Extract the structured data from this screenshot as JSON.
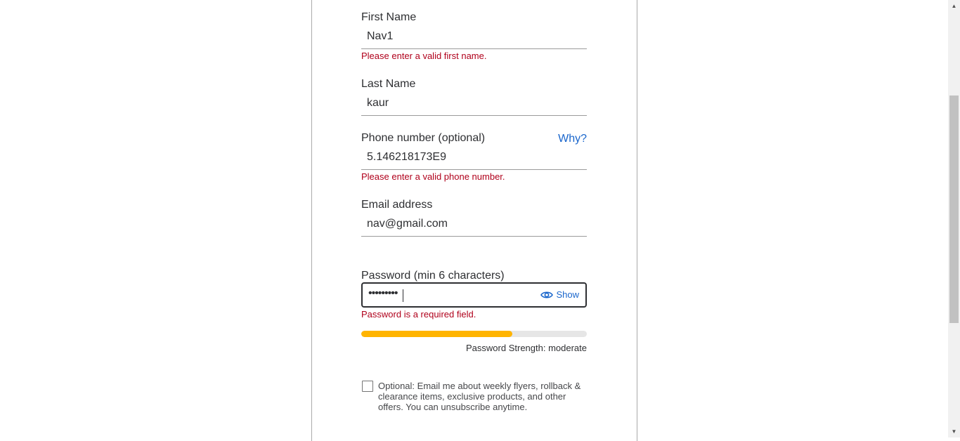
{
  "form": {
    "first_name": {
      "label": "First Name",
      "value": "Nav1",
      "error": "Please enter a valid first name."
    },
    "last_name": {
      "label": "Last Name",
      "value": "kaur"
    },
    "phone": {
      "label": "Phone number (optional)",
      "why": "Why?",
      "value": "5.146218173E9",
      "error": "Please enter a valid phone number."
    },
    "email": {
      "label": "Email address",
      "value": "nav@gmail.com"
    },
    "password": {
      "label": "Password (min 6 characters)",
      "masked": "•••••••••",
      "show_label": "Show",
      "error": "Password is a required field."
    },
    "strength": {
      "text": "Password Strength: moderate",
      "level": 0.67,
      "color": "#ffb400"
    },
    "optin": {
      "text": "Optional: Email me about weekly flyers, rollback & clearance items, exclusive products, and other offers. You can unsubscribe anytime.",
      "checked": false
    }
  },
  "colors": {
    "error": "#b0001b",
    "link": "#1a66cc",
    "text": "#2e2f32"
  },
  "icons": {
    "show": "eye-icon",
    "scroll_up": "arrow-up-icon",
    "scroll_down": "arrow-down-icon"
  }
}
